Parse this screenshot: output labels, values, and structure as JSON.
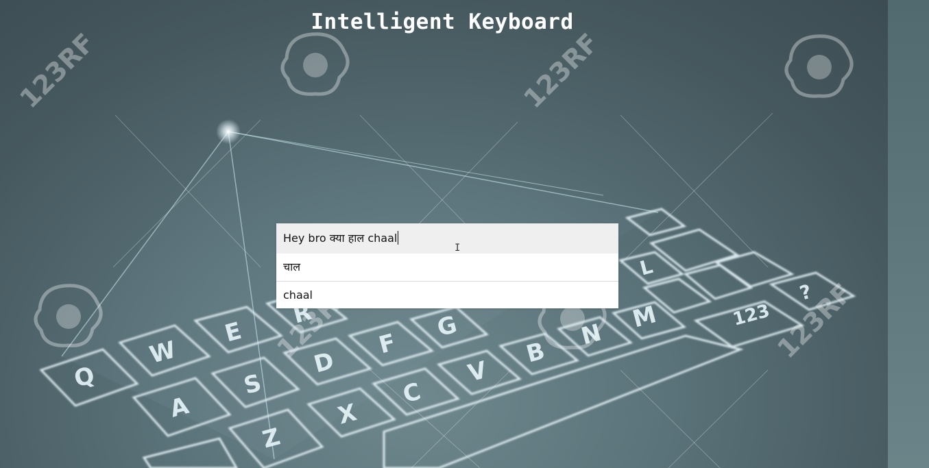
{
  "page": {
    "title": "Intelligent Keyboard"
  },
  "editor": {
    "value": "Hey bro क्या हाल chaal",
    "cursor_icon": "text-ibeam-cursor-icon",
    "suggestions": [
      "चाल",
      "chaal"
    ]
  },
  "background": {
    "watermark": "123RF",
    "keyboard_keys": [
      "Q",
      "W",
      "E",
      "R",
      "A",
      "S",
      "D",
      "F",
      "G",
      "Z",
      "X",
      "C",
      "V",
      "B",
      "N",
      "M",
      "L",
      "123",
      "?"
    ]
  },
  "colors": {
    "background": "#52696f",
    "title": "#ffffff",
    "input_bg": "#efefef",
    "suggestion_bg": "#ffffff",
    "key_glow": "#e8f6fa"
  }
}
